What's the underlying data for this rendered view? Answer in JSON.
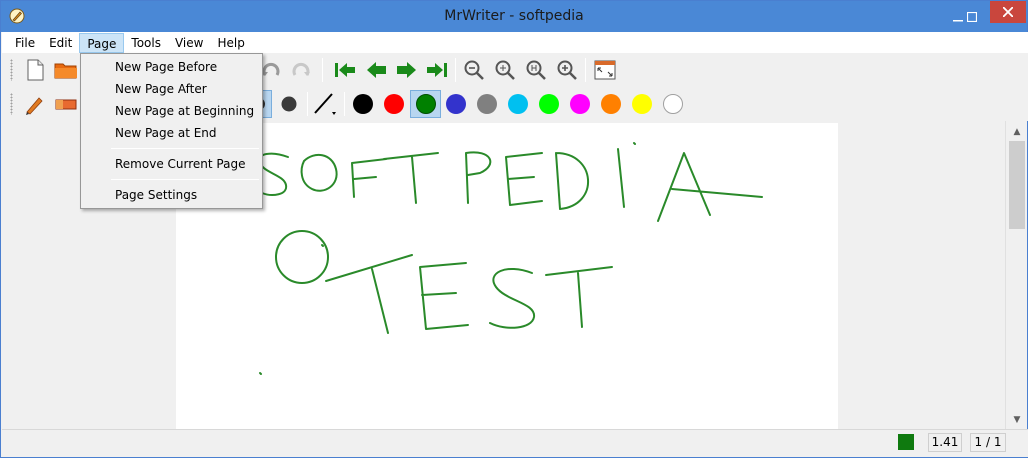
{
  "window": {
    "title": "MrWriter - softpedia"
  },
  "menubar": {
    "items": [
      {
        "label": "File"
      },
      {
        "label": "Edit"
      },
      {
        "label": "Page"
      },
      {
        "label": "Tools"
      },
      {
        "label": "View"
      },
      {
        "label": "Help"
      }
    ],
    "active": "Page"
  },
  "page_menu": {
    "items": [
      {
        "label": "New Page Before"
      },
      {
        "label": "New Page After"
      },
      {
        "label": "New Page at Beginning"
      },
      {
        "label": "New Page at End"
      },
      {
        "label": "Remove Current Page"
      },
      {
        "label": "Page Settings"
      }
    ]
  },
  "toolbar": {
    "icons": [
      "new-file-icon",
      "open-folder-icon",
      "undo-icon",
      "redo-icon",
      "first-page-icon",
      "previous-page-icon",
      "next-page-icon",
      "last-page-icon",
      "zoom-out-icon",
      "zoom-fit-icon",
      "zoom-width-icon",
      "zoom-in-icon",
      "fullscreen-icon"
    ]
  },
  "tools": {
    "icons": [
      "pen-icon",
      "eraser-icon",
      "pen-size-icon",
      "line-style-icon"
    ],
    "colors": [
      {
        "name": "black",
        "hex": "#000000"
      },
      {
        "name": "red",
        "hex": "#ff0000"
      },
      {
        "name": "green",
        "hex": "#008000"
      },
      {
        "name": "blue",
        "hex": "#3333cc"
      },
      {
        "name": "gray",
        "hex": "#808080"
      },
      {
        "name": "cyan",
        "hex": "#00c0f0"
      },
      {
        "name": "lime",
        "hex": "#00ff00"
      },
      {
        "name": "magenta",
        "hex": "#ff00ff"
      },
      {
        "name": "orange",
        "hex": "#ff8000"
      },
      {
        "name": "yellow",
        "hex": "#ffff00"
      },
      {
        "name": "white",
        "hex": "#ffffff"
      }
    ],
    "selected_color": "green"
  },
  "canvas": {
    "ink_color": "#2a8a2a"
  },
  "statusbar": {
    "current_color": "#0f7a0f",
    "zoom": "1.41",
    "pages": "1 / 1"
  }
}
